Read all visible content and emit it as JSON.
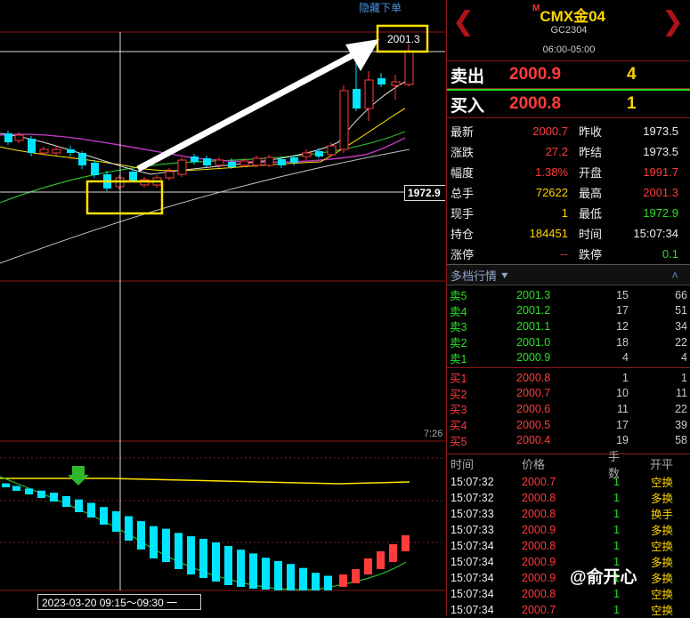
{
  "chart": {
    "hide_order_label": "隐藏下单",
    "high_tag": "2001.3",
    "cross_price_tag": "1972.9",
    "time_mark": "7:26",
    "date_range": "2023-03-20  09:15～09:30 一"
  },
  "instrument": {
    "title": "CMX金04",
    "title_prefix": "M",
    "code": "GC2304",
    "session": "06:00-05:00"
  },
  "quote": {
    "sell_label": "卖出",
    "sell_price": "2000.9",
    "sell_vol": "4",
    "buy_label": "买入",
    "buy_price": "2000.8",
    "buy_vol": "1"
  },
  "stats": [
    {
      "k": "最新",
      "v": "2000.7",
      "vc": "red",
      "k2": "昨收",
      "v2": "1973.5",
      "v2c": "white"
    },
    {
      "k": "涨跌",
      "v": "27.2",
      "vc": "red",
      "k2": "昨结",
      "v2": "1973.5",
      "v2c": "white"
    },
    {
      "k": "幅度",
      "v": "1.38%",
      "vc": "red",
      "k2": "开盘",
      "v2": "1991.7",
      "v2c": "red"
    },
    {
      "k": "总手",
      "v": "72622",
      "vc": "yellow",
      "k2": "最高",
      "v2": "2001.3",
      "v2c": "red"
    },
    {
      "k": "现手",
      "v": "1",
      "vc": "yellow",
      "k2": "最低",
      "v2": "1972.9",
      "v2c": "green"
    },
    {
      "k": "持仓",
      "v": "184451",
      "vc": "yellow",
      "k2": "时间",
      "v2": "15:07:34",
      "v2c": "white"
    },
    {
      "k": "涨停",
      "v": "--",
      "vc": "red",
      "k2": "跌停",
      "v2": "0.1",
      "v2c": "green"
    }
  ],
  "depth": {
    "label": "多档行情",
    "asks": [
      {
        "n": "卖5",
        "p": "2001.3",
        "q": "15",
        "t": "66"
      },
      {
        "n": "卖4",
        "p": "2001.2",
        "q": "17",
        "t": "51"
      },
      {
        "n": "卖3",
        "p": "2001.1",
        "q": "12",
        "t": "34"
      },
      {
        "n": "卖2",
        "p": "2001.0",
        "q": "18",
        "t": "22"
      },
      {
        "n": "卖1",
        "p": "2000.9",
        "q": "4",
        "t": "4"
      }
    ],
    "bids": [
      {
        "n": "买1",
        "p": "2000.8",
        "q": "1",
        "t": "1"
      },
      {
        "n": "买2",
        "p": "2000.7",
        "q": "10",
        "t": "11"
      },
      {
        "n": "买3",
        "p": "2000.6",
        "q": "11",
        "t": "22"
      },
      {
        "n": "买4",
        "p": "2000.5",
        "q": "17",
        "t": "39"
      },
      {
        "n": "买5",
        "p": "2000.4",
        "q": "19",
        "t": "58"
      }
    ]
  },
  "ticks": {
    "headers": [
      "时间",
      "价格",
      "手数",
      "开平"
    ],
    "rows": [
      {
        "t": "15:07:32",
        "p": "2000.7",
        "pc": "red",
        "q": "1",
        "o": "空换",
        "oc": "yellow"
      },
      {
        "t": "15:07:32",
        "p": "2000.8",
        "pc": "red",
        "q": "1",
        "o": "多换",
        "oc": "yellow"
      },
      {
        "t": "15:07:33",
        "p": "2000.8",
        "pc": "red",
        "q": "1",
        "o": "换手",
        "oc": "yellow"
      },
      {
        "t": "15:07:33",
        "p": "2000.9",
        "pc": "red",
        "q": "1",
        "o": "多换",
        "oc": "yellow"
      },
      {
        "t": "15:07:34",
        "p": "2000.8",
        "pc": "red",
        "q": "1",
        "o": "空换",
        "oc": "yellow"
      },
      {
        "t": "15:07:34",
        "p": "2000.9",
        "pc": "red",
        "q": "1",
        "o": "多换",
        "oc": "yellow"
      },
      {
        "t": "15:07:34",
        "p": "2000.9",
        "pc": "red",
        "q": "1",
        "o": "多换",
        "oc": "yellow"
      },
      {
        "t": "15:07:34",
        "p": "2000.8",
        "pc": "red",
        "q": "1",
        "o": "空换",
        "oc": "yellow"
      },
      {
        "t": "15:07:34",
        "p": "2000.7",
        "pc": "red",
        "q": "1",
        "o": "空换",
        "oc": "yellow"
      }
    ]
  },
  "watermark": "@俞开心",
  "colors": {
    "up": "#ff3b3b",
    "down": "#00e5ff",
    "frame": "#8b1a1a",
    "highlight": "#ffe100"
  }
}
